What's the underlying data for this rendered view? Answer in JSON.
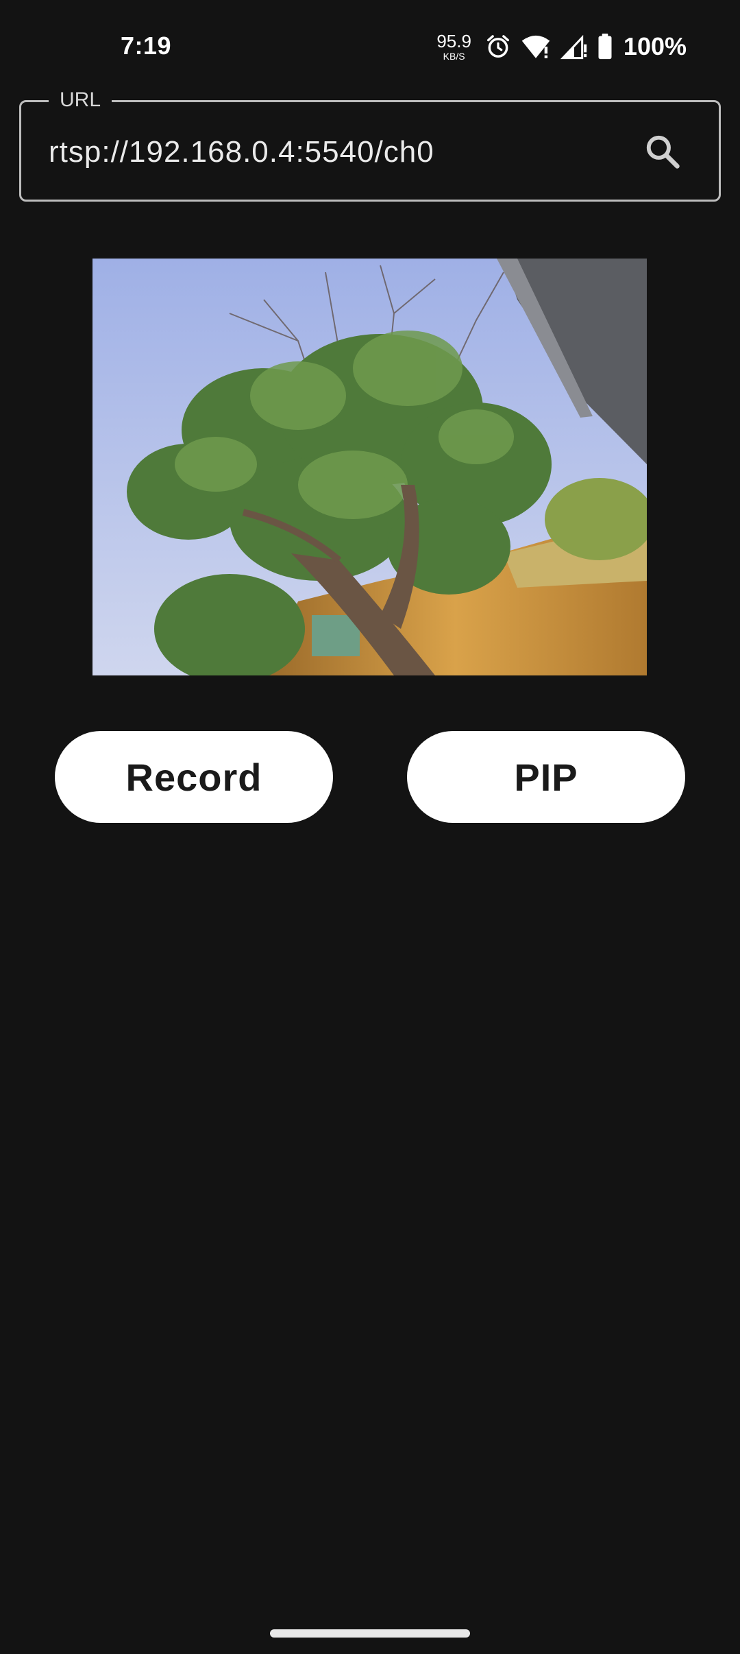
{
  "status_bar": {
    "time": "7:19",
    "net_speed_value": "95.9",
    "net_speed_unit": "KB/S",
    "battery_percent": "100%",
    "icons": [
      "alarm-icon",
      "wifi-icon",
      "cell-signal-icon",
      "battery-icon"
    ]
  },
  "url_field": {
    "label": "URL",
    "value": "rtsp://192.168.0.4:5540/ch0",
    "action_icon": "search-icon"
  },
  "video": {
    "content": "camera-stream"
  },
  "buttons": {
    "record_label": "Record",
    "pip_label": "PIP"
  },
  "colors": {
    "background": "#131313",
    "button_bg": "#ffffff",
    "button_text": "#1a1a1a",
    "field_border": "#bdbdbd"
  }
}
